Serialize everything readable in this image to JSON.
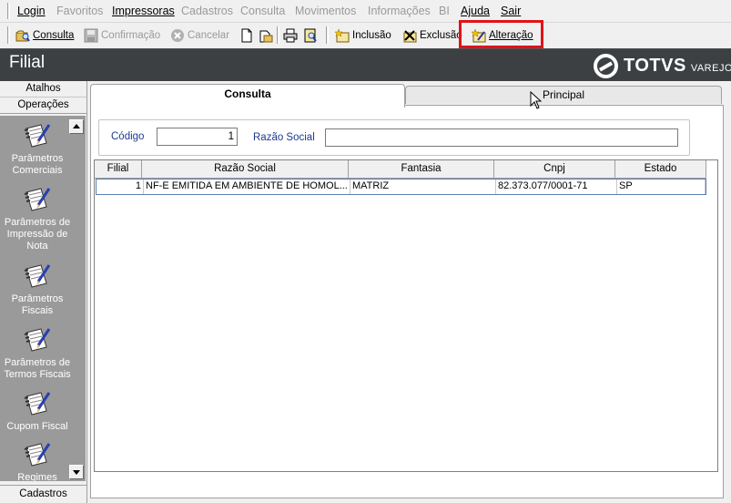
{
  "menu": {
    "items": [
      {
        "label": "Login",
        "enabled": true
      },
      {
        "label": "Favoritos",
        "enabled": false
      },
      {
        "label": "Impressoras",
        "enabled": true
      },
      {
        "label": "Cadastros",
        "enabled": false
      },
      {
        "label": "Consulta",
        "enabled": false
      },
      {
        "label": "Movimentos",
        "enabled": false
      },
      {
        "label": "Informações",
        "enabled": false
      },
      {
        "label": "BI",
        "enabled": false
      },
      {
        "label": "Ajuda",
        "enabled": true
      },
      {
        "label": "Sair",
        "enabled": true
      }
    ]
  },
  "toolbar": {
    "consulta": "Consulta",
    "confirmacao": "Confirmação",
    "cancelar": "Cancelar",
    "inclusao": "Inclusão",
    "exclusao": "Exclusão",
    "alteracao": "Alteração"
  },
  "window": {
    "title": "Filial",
    "logo_brand": "TOTVS",
    "logo_sub": "VAREJO"
  },
  "sidebar": {
    "header_atalhos": "Atalhos",
    "header_operacoes": "Operações",
    "footer_cadastros": "Cadastros",
    "shortcuts": [
      "Parâmetros Comerciais",
      "Parâmetros de Impressão de Nota",
      "Parâmetros Fiscais",
      "Parâmetros de Termos Fiscais",
      "Cupom Fiscal",
      "Regimes"
    ]
  },
  "tabs": {
    "consulta": "Consulta",
    "principal": "Principal"
  },
  "filter": {
    "codigo_label": "Código",
    "codigo_value": "1",
    "razao_label": "Razão Social",
    "razao_value": ""
  },
  "grid": {
    "columns": [
      "Filial",
      "Razão Social",
      "Fantasia",
      "Cnpj",
      "Estado"
    ],
    "rows": [
      [
        "1",
        "NF-E EMITIDA EM AMBIENTE DE HOMOL...",
        "MATRIZ",
        "82.373.077/0001-71",
        "SP"
      ]
    ]
  },
  "colors": {
    "highlight": "#e0121b",
    "titlebar": "#3c4043",
    "label_blue": "#1d3b8f"
  }
}
